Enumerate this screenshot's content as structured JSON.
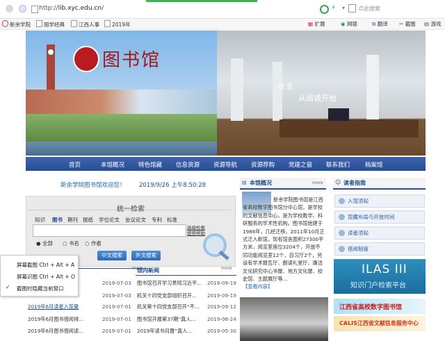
{
  "browser": {
    "url_prefix": "http://",
    "url_host": "lib.xyc.edu.cn",
    "url_suffix": "/",
    "search_placeholder": "点此搜索",
    "bookmarks": [
      "新余学院",
      "国学经典",
      "江西人事",
      "2019年"
    ],
    "toolbar_items": [
      "扩展",
      "网银",
      "翻译",
      "截图",
      "游戏"
    ]
  },
  "banner": {
    "logo_text": "图书馆",
    "slogan_line1": "改 变",
    "slogan_line2": "从阅读开始"
  },
  "menu": [
    "首页",
    "本馆概况",
    "特色馆藏",
    "信息资源",
    "资源导航",
    "资源荐购",
    "党建之窗",
    "联系我们",
    "档案馆"
  ],
  "welcome": "新余学院图书馆欢迎您！",
  "clock": "2019/9/26 上午8:50:28",
  "search": {
    "title": "统一检索",
    "tabs": [
      "知识",
      "图书",
      "期刊",
      "报纸",
      "学位论文",
      "会议论文",
      "专利",
      "标准"
    ],
    "advanced": [
      "高级检索",
      "使用帮助"
    ],
    "radio_options": [
      "全部",
      "书名",
      "作者"
    ],
    "buttons": [
      "中文搜索",
      "外文搜索"
    ]
  },
  "context_menu": {
    "items": [
      "屏幕截图 Ctrl + Alt + A",
      "屏幕识图 Ctrl + Alt + O",
      "截图时隐藏当前窗口"
    ]
  },
  "notice_list": {
    "more": "more",
    "rows": [
      {
        "title": "",
        "date": "2019-07-03"
      },
      {
        "title": "",
        "date": "2019-07-03"
      },
      {
        "title": "2019年6月读者入馆量",
        "date": "2019-07-01"
      },
      {
        "title": "2019年6月图书借阅排...",
        "date": "2019-07-01"
      },
      {
        "title": "2019年6月图书借阅读...",
        "date": "2019-07-01"
      }
    ]
  },
  "news_list": {
    "heading": "馆内新闻",
    "more": "more",
    "rows": [
      {
        "title": "图书馆召开学习贯彻习近平...",
        "date": "2019-09-19"
      },
      {
        "title": "机关十四党支部组织召开...",
        "date": "2019-09-19"
      },
      {
        "title": "机关第十四党支部召开“不...",
        "date": "2019-09-12"
      },
      {
        "title": "图书馆开展第37期“真人...",
        "date": "2019-06-24"
      },
      {
        "title": "2019年读书月暨“真人...",
        "date": "2019-05-30"
      }
    ]
  },
  "overview": {
    "heading": "本馆概况",
    "more": "more",
    "text": "新余学院图书馆是江西省高校数字图书馆分中心馆，是学校的文献信息中心，是为学校教学、科研服务的学术性机构。图书馆始建于1986年，几经迁移，2011年10月正式迁入新馆，现有馆舍面积27300平方米，阅览室座位3204个，开放不同功能阅览室12个，自习厅2个，另设有学术报告厅、朗读礼堂厅、廉洁文化研究中心书屋、地方文化屋、校史馆、主题展厅等…",
    "link": "【查看内容】"
  },
  "reader_guide": {
    "heading": "读者指南",
    "items": [
      "入馆须知",
      "馆藏布局与开放时间",
      "读者须知",
      "借阅制度"
    ]
  },
  "ilas": {
    "title": "ILAS III",
    "subtitle": "知识门户检索平台"
  },
  "promo": [
    "江西省高校数字图书馆",
    "CALIS江西省文献信息服务中心"
  ],
  "colors": {
    "nav_blue": "#2a4d94",
    "accent_red": "#b81c22",
    "link_blue": "#1d6ab3"
  }
}
